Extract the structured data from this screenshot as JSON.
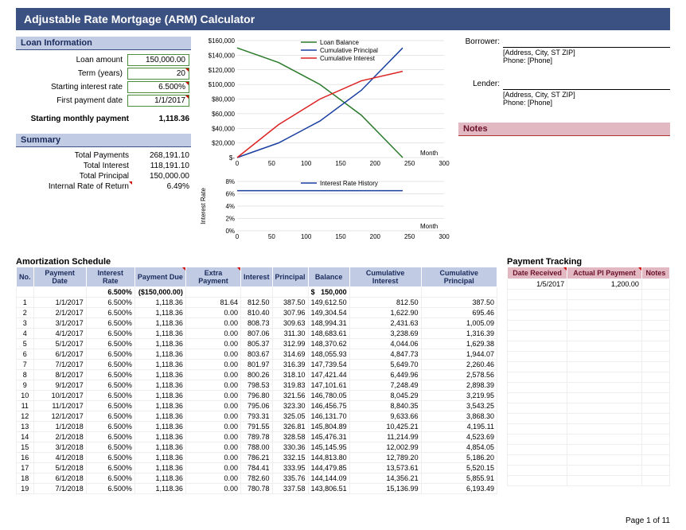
{
  "title": "Adjustable Rate Mortgage (ARM) Calculator",
  "loan_info": {
    "header": "Loan Information",
    "rows": [
      {
        "label": "Loan amount",
        "value": "150,000.00",
        "boxed": true
      },
      {
        "label": "Term (years)",
        "value": "20",
        "boxed": true,
        "red": true
      },
      {
        "label": "Starting interest rate",
        "value": "6.500%",
        "boxed": true,
        "red": true
      },
      {
        "label": "First payment date",
        "value": "1/1/2017",
        "boxed": true,
        "red": true
      }
    ],
    "start_pay_label": "Starting monthly payment",
    "start_pay_value": "1,118.36"
  },
  "summary": {
    "header": "Summary",
    "rows": [
      {
        "label": "Total Payments",
        "value": "268,191.10"
      },
      {
        "label": "Total Interest",
        "value": "118,191.10"
      },
      {
        "label": "Total Principal",
        "value": "150,000.00"
      },
      {
        "label": "Internal Rate of Return",
        "value": "6.49%",
        "red": true
      }
    ]
  },
  "contacts": {
    "borrower_label": "Borrower:",
    "lender_label": "Lender:",
    "addr": "[Address, City, ST ZIP]",
    "phone": "Phone: [Phone]"
  },
  "notes_header": "Notes",
  "amort_title": "Amortization Schedule",
  "track_title": "Payment Tracking",
  "amort_headers": [
    "No.",
    "Payment Date",
    "Interest Rate",
    "Payment Due",
    "Extra Payment",
    "Interest",
    "Principal",
    "Balance",
    "Cumulative Interest",
    "Cumulative Principal"
  ],
  "track_headers": [
    "Date Received",
    "Actual Pl Payment",
    "Notes"
  ],
  "amort_initial": {
    "rate": "6.500%",
    "balance_prefix": "$",
    "balance": "150,000",
    "payment_due": "($150,000.00)"
  },
  "amort_rows": [
    {
      "no": "1",
      "date": "1/1/2017",
      "rate": "6.500%",
      "due": "1,118.36",
      "extra": "81.64",
      "int": "812.50",
      "prin": "387.50",
      "bal": "149,612.50",
      "cint": "812.50",
      "cprin": "387.50"
    },
    {
      "no": "2",
      "date": "2/1/2017",
      "rate": "6.500%",
      "due": "1,118.36",
      "extra": "0.00",
      "int": "810.40",
      "prin": "307.96",
      "bal": "149,304.54",
      "cint": "1,622.90",
      "cprin": "695.46"
    },
    {
      "no": "3",
      "date": "3/1/2017",
      "rate": "6.500%",
      "due": "1,118.36",
      "extra": "0.00",
      "int": "808.73",
      "prin": "309.63",
      "bal": "148,994.31",
      "cint": "2,431.63",
      "cprin": "1,005.09"
    },
    {
      "no": "4",
      "date": "4/1/2017",
      "rate": "6.500%",
      "due": "1,118.36",
      "extra": "0.00",
      "int": "807.06",
      "prin": "311.30",
      "bal": "148,683.61",
      "cint": "3,238.69",
      "cprin": "1,316.39"
    },
    {
      "no": "5",
      "date": "5/1/2017",
      "rate": "6.500%",
      "due": "1,118.36",
      "extra": "0.00",
      "int": "805.37",
      "prin": "312.99",
      "bal": "148,370.62",
      "cint": "4,044.06",
      "cprin": "1,629.38"
    },
    {
      "no": "6",
      "date": "6/1/2017",
      "rate": "6.500%",
      "due": "1,118.36",
      "extra": "0.00",
      "int": "803.67",
      "prin": "314.69",
      "bal": "148,055.93",
      "cint": "4,847.73",
      "cprin": "1,944.07"
    },
    {
      "no": "7",
      "date": "7/1/2017",
      "rate": "6.500%",
      "due": "1,118.36",
      "extra": "0.00",
      "int": "801.97",
      "prin": "316.39",
      "bal": "147,739.54",
      "cint": "5,649.70",
      "cprin": "2,260.46"
    },
    {
      "no": "8",
      "date": "8/1/2017",
      "rate": "6.500%",
      "due": "1,118.36",
      "extra": "0.00",
      "int": "800.26",
      "prin": "318.10",
      "bal": "147,421.44",
      "cint": "6,449.96",
      "cprin": "2,578.56"
    },
    {
      "no": "9",
      "date": "9/1/2017",
      "rate": "6.500%",
      "due": "1,118.36",
      "extra": "0.00",
      "int": "798.53",
      "prin": "319.83",
      "bal": "147,101.61",
      "cint": "7,248.49",
      "cprin": "2,898.39"
    },
    {
      "no": "10",
      "date": "10/1/2017",
      "rate": "6.500%",
      "due": "1,118.36",
      "extra": "0.00",
      "int": "796.80",
      "prin": "321.56",
      "bal": "146,780.05",
      "cint": "8,045.29",
      "cprin": "3,219.95"
    },
    {
      "no": "11",
      "date": "11/1/2017",
      "rate": "6.500%",
      "due": "1,118.36",
      "extra": "0.00",
      "int": "795.06",
      "prin": "323.30",
      "bal": "146,456.75",
      "cint": "8,840.35",
      "cprin": "3,543.25"
    },
    {
      "no": "12",
      "date": "12/1/2017",
      "rate": "6.500%",
      "due": "1,118.36",
      "extra": "0.00",
      "int": "793.31",
      "prin": "325.05",
      "bal": "146,131.70",
      "cint": "9,633.66",
      "cprin": "3,868.30"
    },
    {
      "no": "13",
      "date": "1/1/2018",
      "rate": "6.500%",
      "due": "1,118.36",
      "extra": "0.00",
      "int": "791.55",
      "prin": "326.81",
      "bal": "145,804.89",
      "cint": "10,425.21",
      "cprin": "4,195.11"
    },
    {
      "no": "14",
      "date": "2/1/2018",
      "rate": "6.500%",
      "due": "1,118.36",
      "extra": "0.00",
      "int": "789.78",
      "prin": "328.58",
      "bal": "145,476.31",
      "cint": "11,214.99",
      "cprin": "4,523.69"
    },
    {
      "no": "15",
      "date": "3/1/2018",
      "rate": "6.500%",
      "due": "1,118.36",
      "extra": "0.00",
      "int": "788.00",
      "prin": "330.36",
      "bal": "145,145.95",
      "cint": "12,002.99",
      "cprin": "4,854.05"
    },
    {
      "no": "16",
      "date": "4/1/2018",
      "rate": "6.500%",
      "due": "1,118.36",
      "extra": "0.00",
      "int": "786.21",
      "prin": "332.15",
      "bal": "144,813.80",
      "cint": "12,789.20",
      "cprin": "5,186.20"
    },
    {
      "no": "17",
      "date": "5/1/2018",
      "rate": "6.500%",
      "due": "1,118.36",
      "extra": "0.00",
      "int": "784.41",
      "prin": "333.95",
      "bal": "144,479.85",
      "cint": "13,573.61",
      "cprin": "5,520.15"
    },
    {
      "no": "18",
      "date": "6/1/2018",
      "rate": "6.500%",
      "due": "1,118.36",
      "extra": "0.00",
      "int": "782.60",
      "prin": "335.76",
      "bal": "144,144.09",
      "cint": "14,356.21",
      "cprin": "5,855.91"
    },
    {
      "no": "19",
      "date": "7/1/2018",
      "rate": "6.500%",
      "due": "1,118.36",
      "extra": "0.00",
      "int": "780.78",
      "prin": "337.58",
      "bal": "143,806.51",
      "cint": "15,136.99",
      "cprin": "6,193.49"
    }
  ],
  "track_rows": [
    {
      "date": "1/5/2017",
      "pay": "1,200.00",
      "notes": ""
    }
  ],
  "page_label": "Page 1 of 11",
  "chart_data": [
    {
      "type": "line",
      "title": "",
      "xlabel": "Month",
      "ylabel": "",
      "xlim": [
        0,
        300
      ],
      "ylim": [
        0,
        160000
      ],
      "x_ticks": [
        0,
        50,
        100,
        150,
        200,
        250,
        300
      ],
      "y_ticks": [
        "$-",
        "$20,000",
        "$40,000",
        "$60,000",
        "$80,000",
        "$100,000",
        "$120,000",
        "$140,000",
        "$160,000"
      ],
      "series": [
        {
          "name": "Loan Balance",
          "color": "#2a7a2a",
          "x": [
            0,
            60,
            120,
            180,
            240
          ],
          "y": [
            150000,
            130000,
            100000,
            58000,
            0
          ]
        },
        {
          "name": "Cumulative Principal",
          "color": "#1a3fa0",
          "x": [
            0,
            60,
            120,
            180,
            240
          ],
          "y": [
            0,
            20000,
            50000,
            92000,
            150000
          ]
        },
        {
          "name": "Cumulative Interest",
          "color": "#d22",
          "x": [
            0,
            60,
            120,
            180,
            240
          ],
          "y": [
            0,
            45000,
            80000,
            105000,
            118000
          ]
        }
      ]
    },
    {
      "type": "line",
      "title": "",
      "xlabel": "Month",
      "ylabel": "Interest Rate",
      "xlim": [
        0,
        300
      ],
      "ylim": [
        0,
        8
      ],
      "x_ticks": [
        0,
        50,
        100,
        150,
        200,
        250,
        300
      ],
      "y_ticks": [
        "0%",
        "2%",
        "4%",
        "6%",
        "8%"
      ],
      "series": [
        {
          "name": "Interest Rate History",
          "color": "#1a3fa0",
          "x": [
            0,
            240
          ],
          "y": [
            6.5,
            6.5
          ]
        }
      ]
    }
  ]
}
